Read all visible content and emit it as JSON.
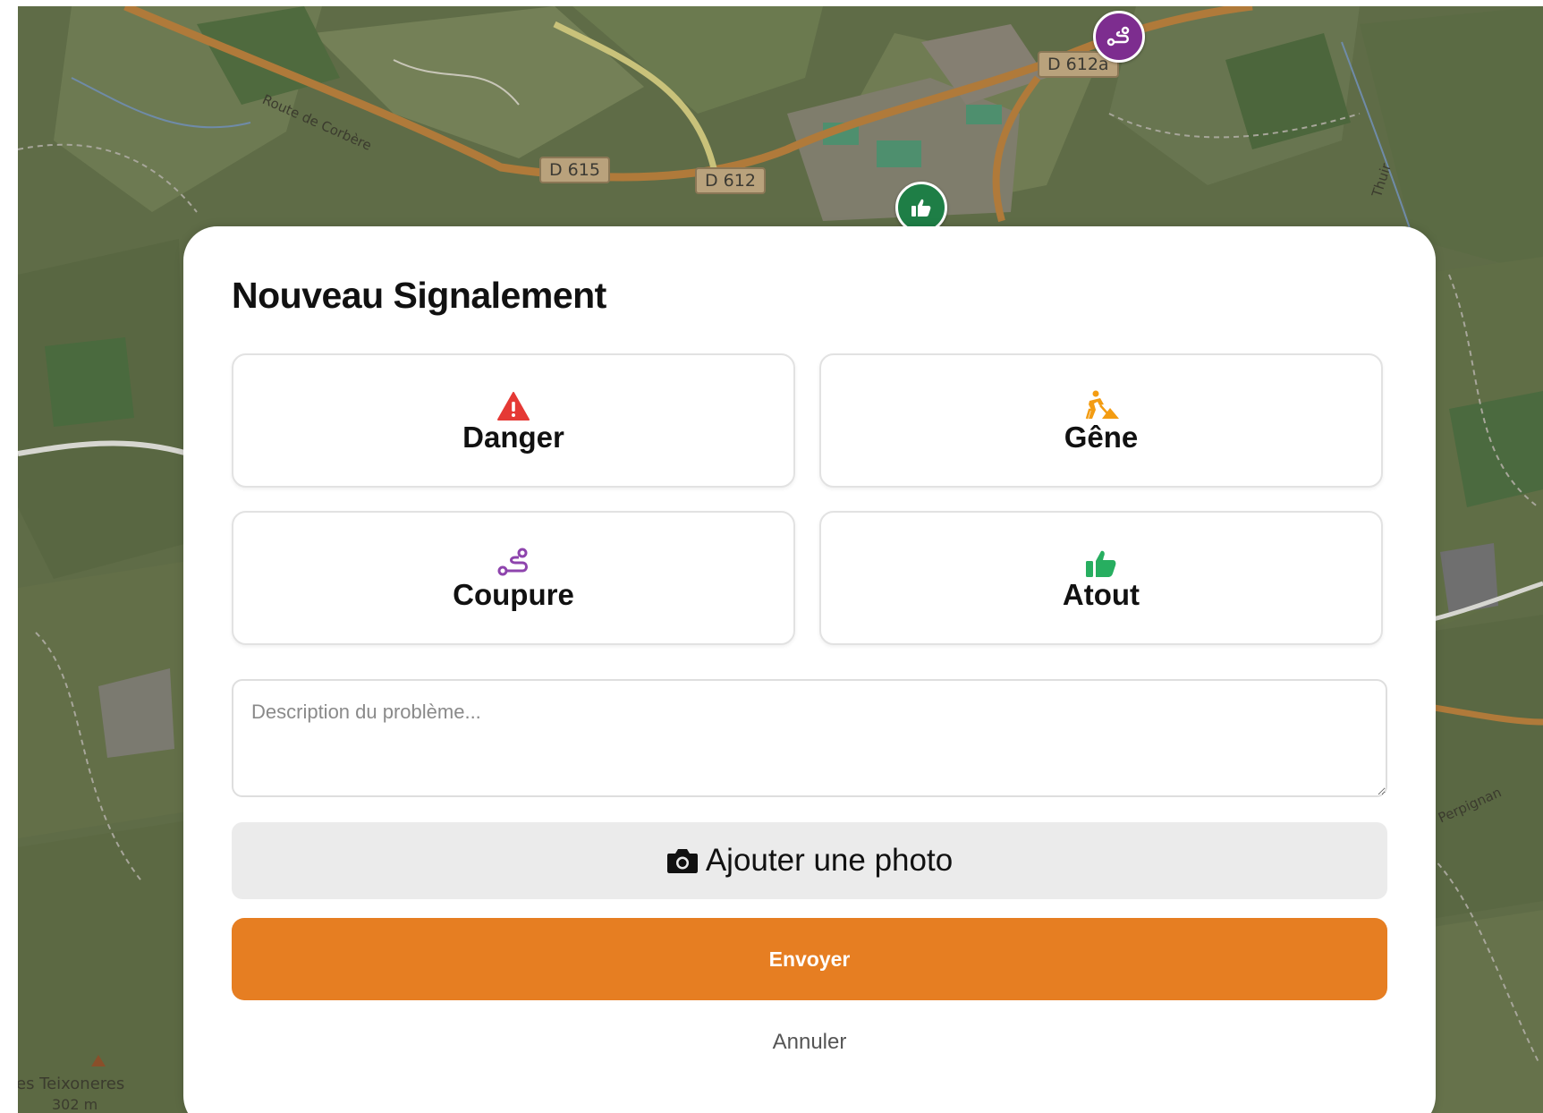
{
  "map": {
    "road_labels": [
      "D 615",
      "D 612",
      "D 612a"
    ],
    "street_names": [
      "Route de Corbère",
      "Thuir",
      "Perpignan"
    ],
    "peak_name": "es Teixoneres",
    "peak_elevation": "302 m",
    "markers": [
      {
        "kind": "coupure",
        "icon": "route-icon",
        "color": "#7d2d8f"
      },
      {
        "kind": "atout",
        "icon": "thumbs-up-icon",
        "color": "#1e7e46"
      }
    ]
  },
  "modal": {
    "title": "Nouveau Signalement",
    "types": [
      {
        "label": "Danger",
        "icon": "warning-triangle-icon",
        "color": "#e53935"
      },
      {
        "label": "Gêne",
        "icon": "roadwork-icon",
        "color": "#f39c12"
      },
      {
        "label": "Coupure",
        "icon": "route-icon",
        "color": "#8e44ad"
      },
      {
        "label": "Atout",
        "icon": "thumbs-up-icon",
        "color": "#27ae60"
      }
    ],
    "description_placeholder": "Description du problème...",
    "photo_label": "Ajouter une photo",
    "send_label": "Envoyer",
    "cancel_label": "Annuler"
  },
  "colors": {
    "accent": "#e67e22",
    "photo_button_bg": "#ebebeb"
  }
}
